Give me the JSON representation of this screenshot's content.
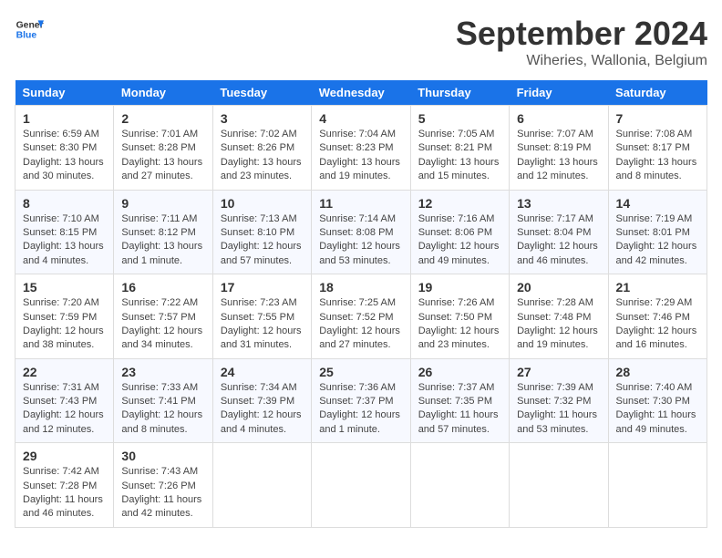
{
  "app": {
    "name": "GeneralBlue",
    "logo_text_1": "General",
    "logo_text_2": "Blue"
  },
  "calendar": {
    "month": "September 2024",
    "location": "Wiheries, Wallonia, Belgium",
    "days_of_week": [
      "Sunday",
      "Monday",
      "Tuesday",
      "Wednesday",
      "Thursday",
      "Friday",
      "Saturday"
    ],
    "weeks": [
      [
        null,
        null,
        null,
        null,
        null,
        null,
        null
      ]
    ]
  },
  "cells": {
    "empty": "",
    "w1": [
      {
        "num": "1",
        "info": "Sunrise: 6:59 AM\nSunset: 8:30 PM\nDaylight: 13 hours\nand 30 minutes."
      },
      {
        "num": "2",
        "info": "Sunrise: 7:01 AM\nSunset: 8:28 PM\nDaylight: 13 hours\nand 27 minutes."
      },
      {
        "num": "3",
        "info": "Sunrise: 7:02 AM\nSunset: 8:26 PM\nDaylight: 13 hours\nand 23 minutes."
      },
      {
        "num": "4",
        "info": "Sunrise: 7:04 AM\nSunset: 8:23 PM\nDaylight: 13 hours\nand 19 minutes."
      },
      {
        "num": "5",
        "info": "Sunrise: 7:05 AM\nSunset: 8:21 PM\nDaylight: 13 hours\nand 15 minutes."
      },
      {
        "num": "6",
        "info": "Sunrise: 7:07 AM\nSunset: 8:19 PM\nDaylight: 13 hours\nand 12 minutes."
      },
      {
        "num": "7",
        "info": "Sunrise: 7:08 AM\nSunset: 8:17 PM\nDaylight: 13 hours\nand 8 minutes."
      }
    ],
    "w2": [
      {
        "num": "8",
        "info": "Sunrise: 7:10 AM\nSunset: 8:15 PM\nDaylight: 13 hours\nand 4 minutes."
      },
      {
        "num": "9",
        "info": "Sunrise: 7:11 AM\nSunset: 8:12 PM\nDaylight: 13 hours\nand 1 minute."
      },
      {
        "num": "10",
        "info": "Sunrise: 7:13 AM\nSunset: 8:10 PM\nDaylight: 12 hours\nand 57 minutes."
      },
      {
        "num": "11",
        "info": "Sunrise: 7:14 AM\nSunset: 8:08 PM\nDaylight: 12 hours\nand 53 minutes."
      },
      {
        "num": "12",
        "info": "Sunrise: 7:16 AM\nSunset: 8:06 PM\nDaylight: 12 hours\nand 49 minutes."
      },
      {
        "num": "13",
        "info": "Sunrise: 7:17 AM\nSunset: 8:04 PM\nDaylight: 12 hours\nand 46 minutes."
      },
      {
        "num": "14",
        "info": "Sunrise: 7:19 AM\nSunset: 8:01 PM\nDaylight: 12 hours\nand 42 minutes."
      }
    ],
    "w3": [
      {
        "num": "15",
        "info": "Sunrise: 7:20 AM\nSunset: 7:59 PM\nDaylight: 12 hours\nand 38 minutes."
      },
      {
        "num": "16",
        "info": "Sunrise: 7:22 AM\nSunset: 7:57 PM\nDaylight: 12 hours\nand 34 minutes."
      },
      {
        "num": "17",
        "info": "Sunrise: 7:23 AM\nSunset: 7:55 PM\nDaylight: 12 hours\nand 31 minutes."
      },
      {
        "num": "18",
        "info": "Sunrise: 7:25 AM\nSunset: 7:52 PM\nDaylight: 12 hours\nand 27 minutes."
      },
      {
        "num": "19",
        "info": "Sunrise: 7:26 AM\nSunset: 7:50 PM\nDaylight: 12 hours\nand 23 minutes."
      },
      {
        "num": "20",
        "info": "Sunrise: 7:28 AM\nSunset: 7:48 PM\nDaylight: 12 hours\nand 19 minutes."
      },
      {
        "num": "21",
        "info": "Sunrise: 7:29 AM\nSunset: 7:46 PM\nDaylight: 12 hours\nand 16 minutes."
      }
    ],
    "w4": [
      {
        "num": "22",
        "info": "Sunrise: 7:31 AM\nSunset: 7:43 PM\nDaylight: 12 hours\nand 12 minutes."
      },
      {
        "num": "23",
        "info": "Sunrise: 7:33 AM\nSunset: 7:41 PM\nDaylight: 12 hours\nand 8 minutes."
      },
      {
        "num": "24",
        "info": "Sunrise: 7:34 AM\nSunset: 7:39 PM\nDaylight: 12 hours\nand 4 minutes."
      },
      {
        "num": "25",
        "info": "Sunrise: 7:36 AM\nSunset: 7:37 PM\nDaylight: 12 hours\nand 1 minute."
      },
      {
        "num": "26",
        "info": "Sunrise: 7:37 AM\nSunset: 7:35 PM\nDaylight: 11 hours\nand 57 minutes."
      },
      {
        "num": "27",
        "info": "Sunrise: 7:39 AM\nSunset: 7:32 PM\nDaylight: 11 hours\nand 53 minutes."
      },
      {
        "num": "28",
        "info": "Sunrise: 7:40 AM\nSunset: 7:30 PM\nDaylight: 11 hours\nand 49 minutes."
      }
    ],
    "w5": [
      {
        "num": "29",
        "info": "Sunrise: 7:42 AM\nSunset: 7:28 PM\nDaylight: 11 hours\nand 46 minutes."
      },
      {
        "num": "30",
        "info": "Sunrise: 7:43 AM\nSunset: 7:26 PM\nDaylight: 11 hours\nand 42 minutes."
      },
      null,
      null,
      null,
      null,
      null
    ]
  }
}
